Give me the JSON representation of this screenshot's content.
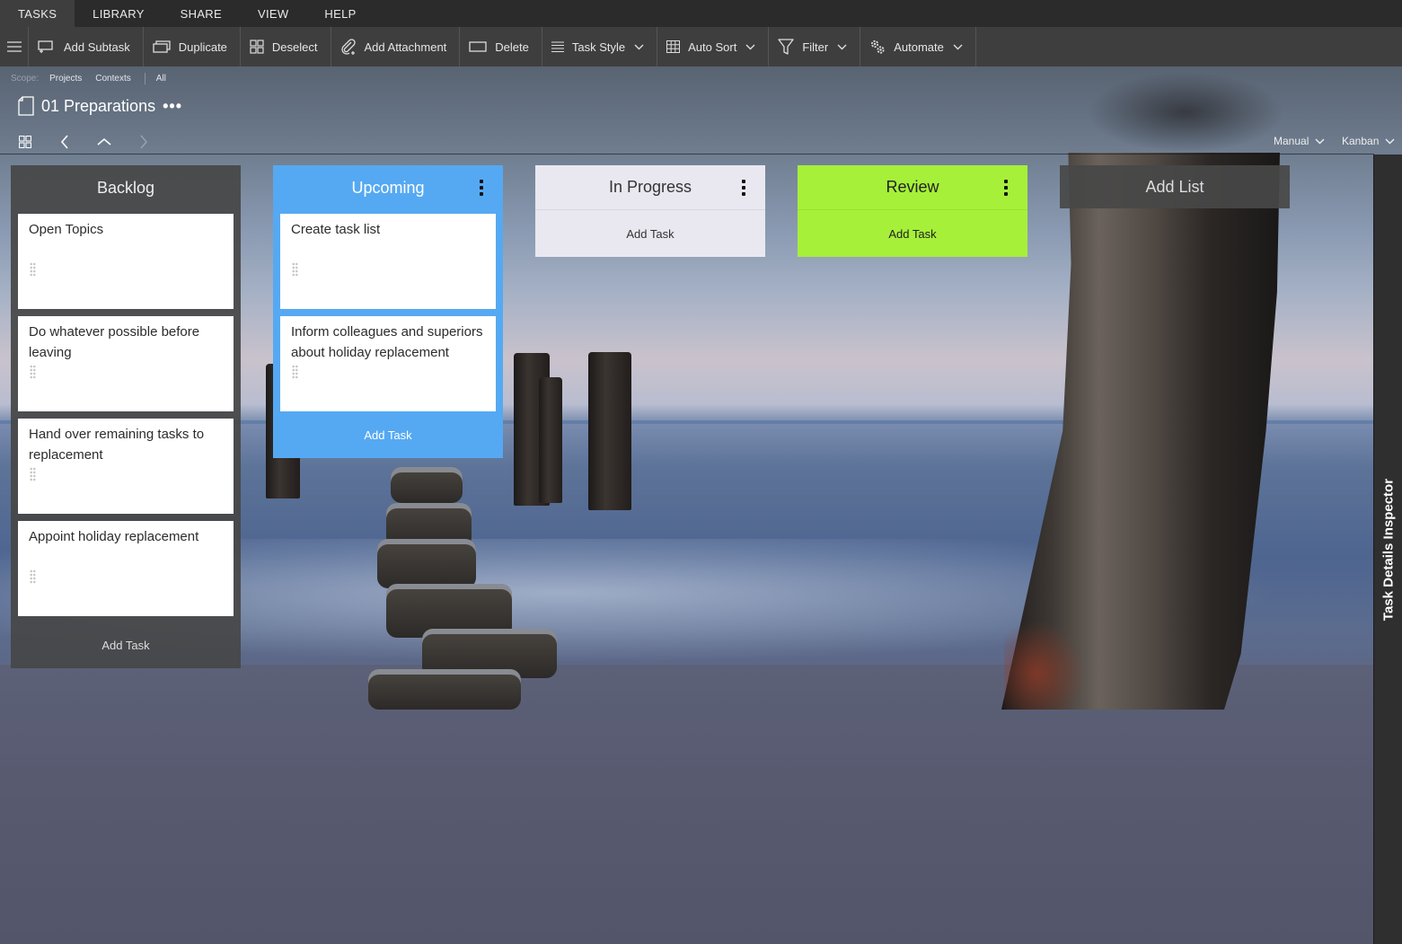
{
  "menu": {
    "tabs": [
      "TASKS",
      "LIBRARY",
      "SHARE",
      "VIEW",
      "HELP"
    ],
    "active": "TASKS"
  },
  "toolbar": {
    "add_subtask": "Add Subtask",
    "duplicate": "Duplicate",
    "deselect": "Deselect",
    "add_attachment": "Add Attachment",
    "delete": "Delete",
    "task_style": "Task Style",
    "auto_sort": "Auto Sort",
    "filter": "Filter",
    "automate": "Automate"
  },
  "scope": {
    "label": "Scope:",
    "projects": "Projects",
    "contexts": "Contexts",
    "all": "All"
  },
  "project": {
    "title": "01 Preparations",
    "more": "•••"
  },
  "view": {
    "sort": "Manual",
    "layout": "Kanban"
  },
  "columns": {
    "backlog": {
      "title": "Backlog",
      "add_task": "Add Task",
      "cards": [
        "Open Topics",
        "Do whatever possible before leaving",
        "Hand over remaining tasks to replacement",
        "Appoint holiday replacement"
      ]
    },
    "upcoming": {
      "title": "Upcoming",
      "color": "#55a9f2",
      "add_task": "Add Task",
      "cards": [
        "Create task list",
        "Inform colleagues and superiors about holiday replacement"
      ]
    },
    "in_progress": {
      "title": "In Progress",
      "color": "#e9e8f0",
      "add_task": "Add Task",
      "cards": []
    },
    "review": {
      "title": "Review",
      "color": "#a6f03a",
      "add_task": "Add Task",
      "cards": []
    }
  },
  "add_list": "Add List",
  "inspector": {
    "label": "Task Details Inspector"
  }
}
